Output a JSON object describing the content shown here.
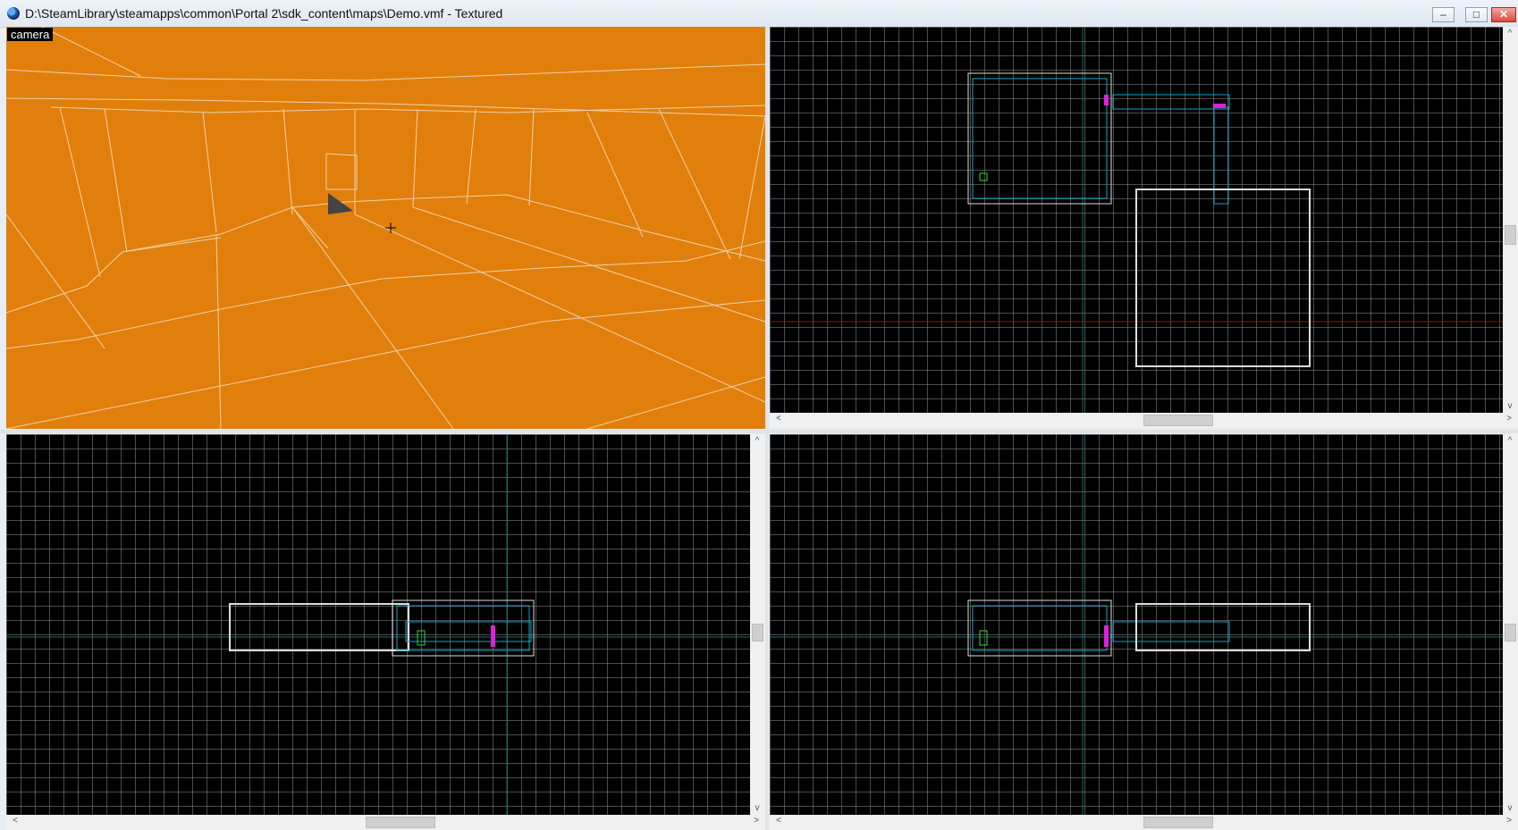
{
  "window": {
    "title": "D:\\SteamLibrary\\steamapps\\common\\Portal 2\\sdk_content\\maps\\Demo.vmf - Textured",
    "buttons": {
      "minimize": "–",
      "maximize": "□",
      "close": "✕"
    }
  },
  "camera_view": {
    "label": "camera",
    "background_color": "#e07f0c"
  },
  "scroll_arrows": {
    "left": "<",
    "right": ">",
    "up": "^",
    "down": "v"
  },
  "icons": [
    "app-icon",
    "minimize-icon",
    "maximize-icon",
    "close-icon",
    "crosshair-icon"
  ]
}
